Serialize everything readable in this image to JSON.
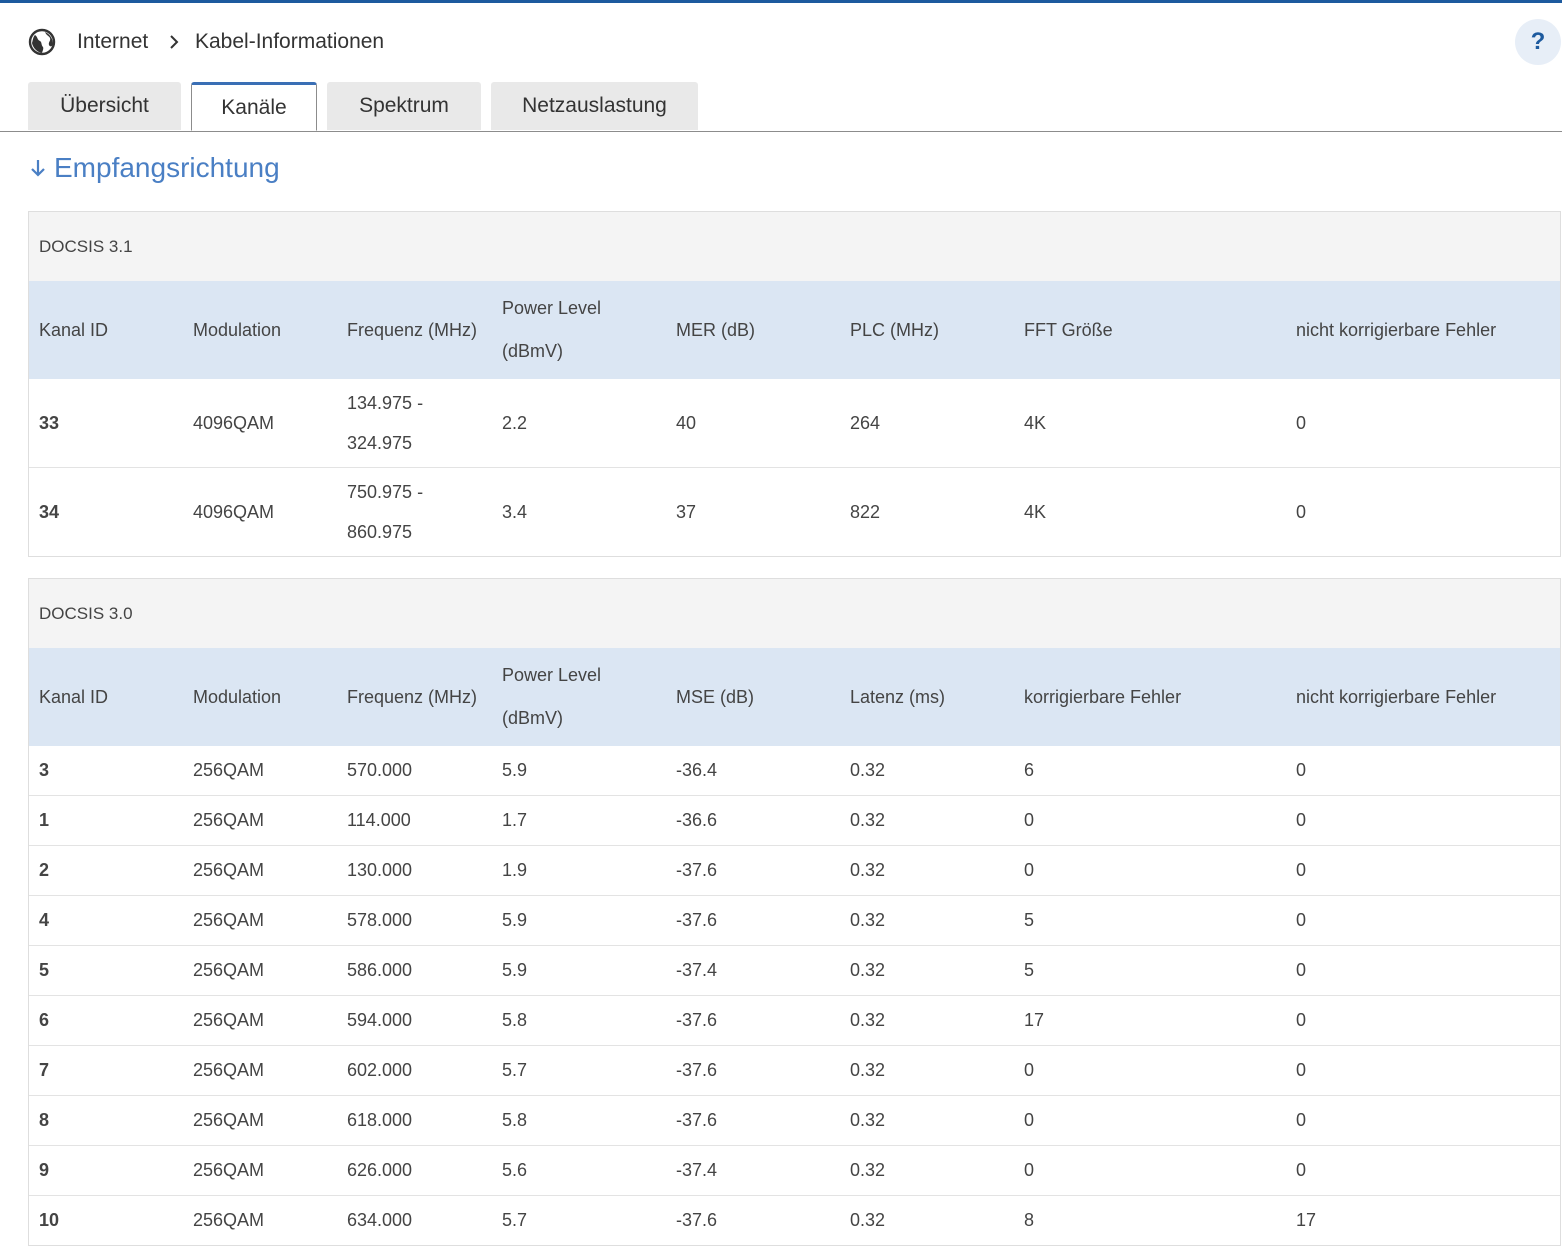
{
  "breadcrumb": {
    "items": [
      "Internet",
      "Kabel-Informationen"
    ]
  },
  "help_label": "?",
  "tabs": [
    {
      "label": "Übersicht",
      "active": false
    },
    {
      "label": "Kanäle",
      "active": true
    },
    {
      "label": "Spektrum",
      "active": false
    },
    {
      "label": "Netzauslastung",
      "active": false
    }
  ],
  "section_title": "Empfangsrichtung",
  "docsis31": {
    "title": "DOCSIS 3.1",
    "columns": [
      "Kanal ID",
      "Modulation",
      "Frequenz (MHz)",
      "Power Level (dBmV)",
      "MER (dB)",
      "PLC (MHz)",
      "FFT Größe",
      "nicht korrigierbare Fehler"
    ],
    "rows": [
      [
        "33",
        "4096QAM",
        "134.975 - 324.975",
        "2.2",
        "40",
        "264",
        "4K",
        "0"
      ],
      [
        "34",
        "4096QAM",
        "750.975 - 860.975",
        "3.4",
        "37",
        "822",
        "4K",
        "0"
      ]
    ]
  },
  "docsis30": {
    "title": "DOCSIS 3.0",
    "columns": [
      "Kanal ID",
      "Modulation",
      "Frequenz (MHz)",
      "Power Level (dBmV)",
      "MSE (dB)",
      "Latenz (ms)",
      "korrigierbare Fehler",
      "nicht korrigierbare Fehler"
    ],
    "rows": [
      [
        "3",
        "256QAM",
        "570.000",
        "5.9",
        "-36.4",
        "0.32",
        "6",
        "0"
      ],
      [
        "1",
        "256QAM",
        "114.000",
        "1.7",
        "-36.6",
        "0.32",
        "0",
        "0"
      ],
      [
        "2",
        "256QAM",
        "130.000",
        "1.9",
        "-37.6",
        "0.32",
        "0",
        "0"
      ],
      [
        "4",
        "256QAM",
        "578.000",
        "5.9",
        "-37.6",
        "0.32",
        "5",
        "0"
      ],
      [
        "5",
        "256QAM",
        "586.000",
        "5.9",
        "-37.4",
        "0.32",
        "5",
        "0"
      ],
      [
        "6",
        "256QAM",
        "594.000",
        "5.8",
        "-37.6",
        "0.32",
        "17",
        "0"
      ],
      [
        "7",
        "256QAM",
        "602.000",
        "5.7",
        "-37.6",
        "0.32",
        "0",
        "0"
      ],
      [
        "8",
        "256QAM",
        "618.000",
        "5.8",
        "-37.6",
        "0.32",
        "0",
        "0"
      ],
      [
        "9",
        "256QAM",
        "626.000",
        "5.6",
        "-37.4",
        "0.32",
        "0",
        "0"
      ],
      [
        "10",
        "256QAM",
        "634.000",
        "5.7",
        "-37.6",
        "0.32",
        "8",
        "17"
      ]
    ]
  },
  "colors": {
    "accent": "#3a6fb5",
    "title": "#4a7fc4",
    "header_bg": "#dbe6f3",
    "topbar": "#1d5a9e"
  },
  "icons": {
    "globe": "globe-icon",
    "breadcrumb_separator": "chevron-right-icon",
    "section": "arrow-down-icon",
    "help": "help-icon"
  }
}
